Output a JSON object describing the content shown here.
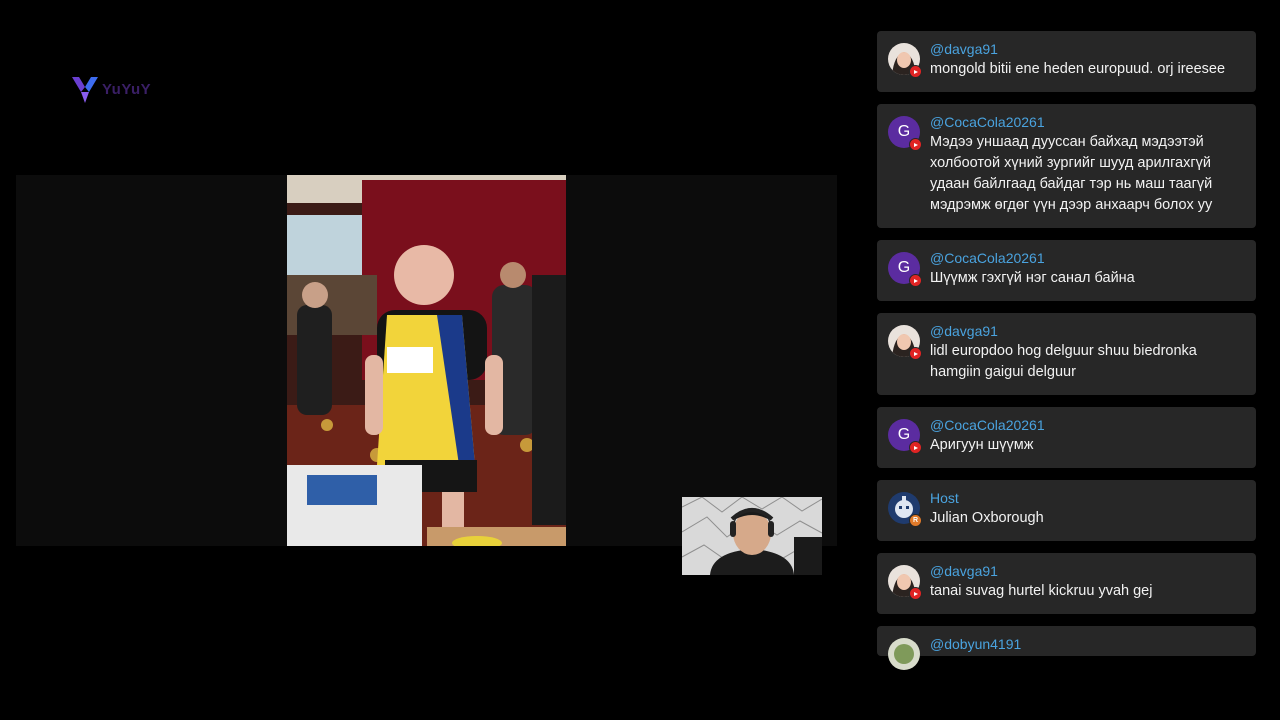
{
  "logo": {
    "word": "YuYuY"
  },
  "chat": {
    "messages": [
      {
        "author": "@davga91",
        "text": "mongold bitii ene heden europuud. orj ireesee",
        "avatar": "photo-woman",
        "source": "youtube"
      },
      {
        "author": "@CocaCola20261",
        "text": "Мэдээ уншаад дууссан байхад мэдээтэй холбоотой хүний зургийг шууд арилгахгүй удаан байлгаад байдаг тэр нь маш таагүй мэдрэмж өгдөг үүн дээр анхаарч болох уу",
        "avatar_letter": "G",
        "source": "youtube"
      },
      {
        "author": "@CocaCola20261",
        "text": "Шүүмж гэхгүй нэг санал байна",
        "avatar_letter": "G",
        "source": "youtube"
      },
      {
        "author": "@davga91",
        "text": "lidl europdoo hog delguur shuu biedronka hamgiin gaigui delguur",
        "avatar": "photo-woman",
        "source": "youtube"
      },
      {
        "author": "@CocaCola20261",
        "text": "Аригуун шүүмж",
        "avatar_letter": "G",
        "source": "youtube"
      },
      {
        "author": "Host",
        "text": "Julian Oxborough",
        "avatar": "host-robot",
        "source": "restream",
        "badge_letter": "R"
      },
      {
        "author": "@davga91",
        "text": "tanai suvag hurtel kickruu yvah gej",
        "avatar": "photo-woman",
        "source": "youtube"
      },
      {
        "author": "@dobyun4191",
        "text": "",
        "avatar": "photo-green",
        "source": "youtube"
      }
    ]
  },
  "colors": {
    "author": "#4aa3df",
    "card": "#272727",
    "youtube_badge": "#e02424",
    "letter_avatar": "#5b2ca0"
  }
}
